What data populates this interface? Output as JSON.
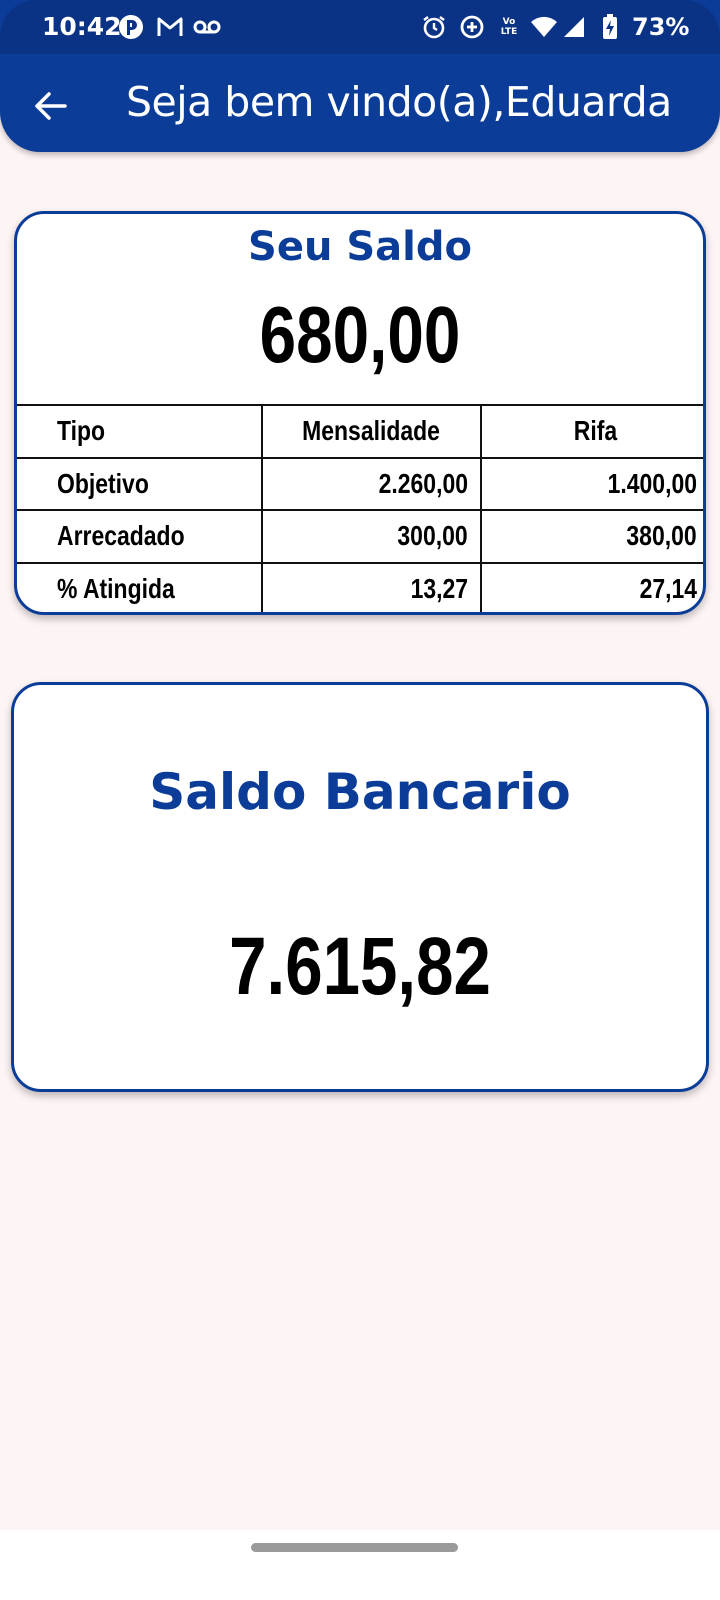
{
  "status_bar": {
    "time": "10:42",
    "battery": "73%",
    "icons": [
      "app-p-icon",
      "gmail-icon",
      "voicemail-icon",
      "alarm-icon",
      "data-saver-icon",
      "volte-icon",
      "wifi-icon",
      "signal-icon",
      "battery-charging-icon"
    ],
    "volte_label": "LTE"
  },
  "app_bar": {
    "title": "Seja bem vindo(a),Eduarda",
    "back_icon": "arrow-back-icon"
  },
  "balance_card": {
    "title": "Seu Saldo",
    "value": "680,00",
    "table": {
      "headers": [
        "Tipo",
        "Mensalidade",
        "Rifa"
      ],
      "rows": [
        [
          "Objetivo",
          "2.260,00",
          "1.400,00"
        ],
        [
          "Arrecadado",
          "300,00",
          "380,00"
        ],
        [
          "% Atingida",
          "13,27",
          "27,14"
        ]
      ]
    }
  },
  "bank_card": {
    "title": "Saldo Bancario",
    "value": "7.615,82"
  },
  "colors": {
    "primary": "#0b3d98",
    "status_bar": "#0a3385",
    "background": "#fdf4f4",
    "card": "#ffffff"
  }
}
